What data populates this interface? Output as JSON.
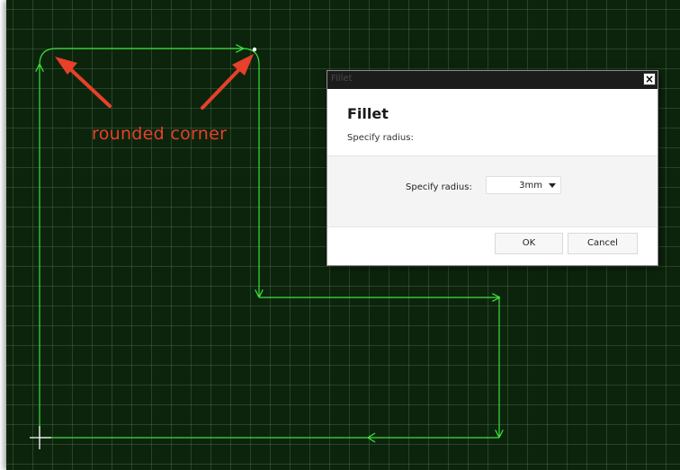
{
  "annotation": {
    "text": "rounded corner",
    "color": "#e8402a"
  },
  "canvas": {
    "background": "#0c240c",
    "line_color": "#3fe03f"
  },
  "dialog": {
    "window_title": "Fillet",
    "close_label": "×",
    "heading": "Fillet",
    "subheading": "Specify radius:",
    "field_label": "Specify radius:",
    "radius_value": "3mm",
    "ok_label": "OK",
    "cancel_label": "Cancel"
  }
}
